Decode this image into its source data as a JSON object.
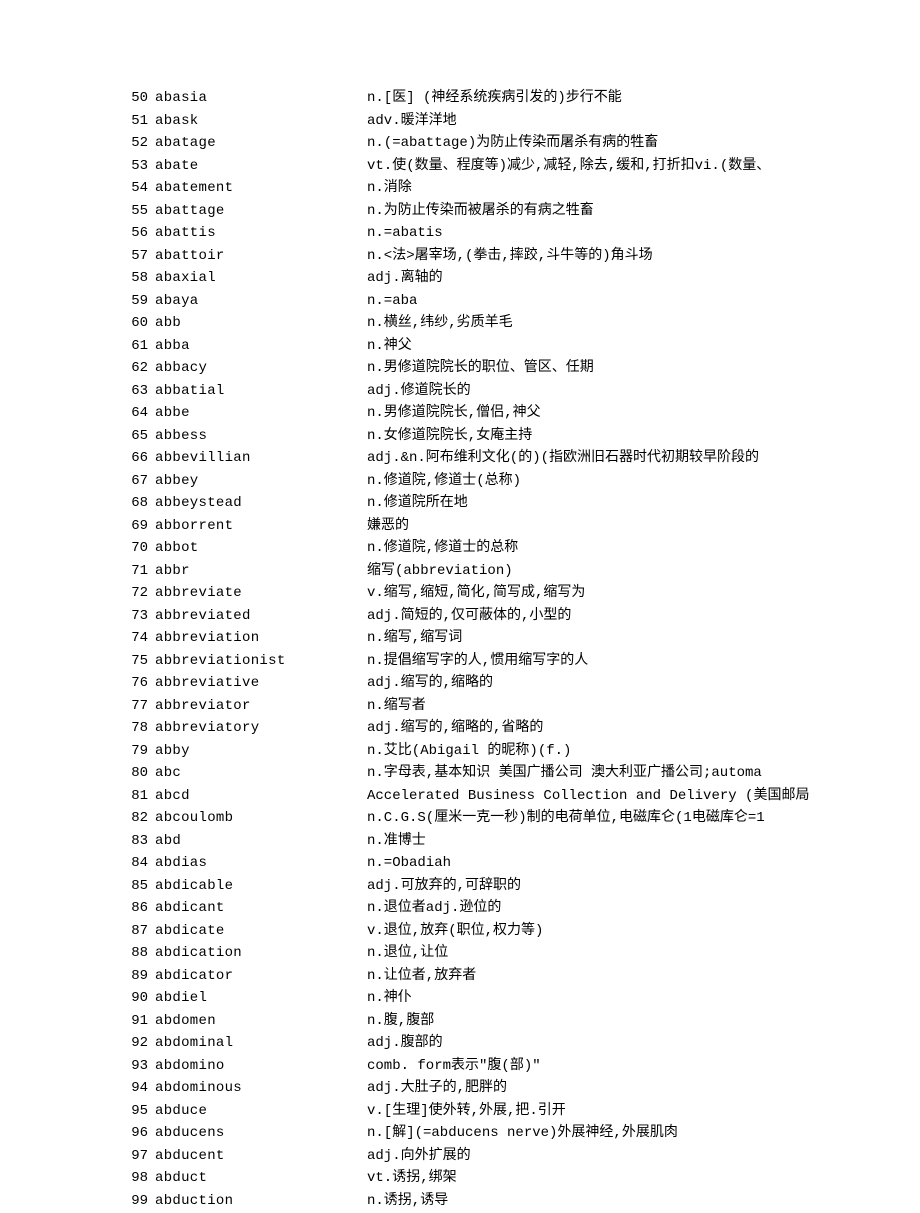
{
  "entries": [
    {
      "num": "50",
      "word": "abasia",
      "def": "n.[医] (神经系统疾病引发的)步行不能"
    },
    {
      "num": "51",
      "word": "abask",
      "def": "adv.暖洋洋地"
    },
    {
      "num": "52",
      "word": "abatage",
      "def": "n.(=abattage)为防止传染而屠杀有病的牲畜"
    },
    {
      "num": "53",
      "word": "abate",
      "def": "vt.使(数量、程度等)减少,减轻,除去,缓和,打折扣vi.(数量、"
    },
    {
      "num": "54",
      "word": "abatement",
      "def": "n.消除"
    },
    {
      "num": "55",
      "word": "abattage",
      "def": "n.为防止传染而被屠杀的有病之牲畜"
    },
    {
      "num": "56",
      "word": "abattis",
      "def": "n.=abatis"
    },
    {
      "num": "57",
      "word": "abattoir",
      "def": "n.<法>屠宰场,(拳击,摔跤,斗牛等的)角斗场"
    },
    {
      "num": "58",
      "word": "abaxial",
      "def": "adj.离轴的"
    },
    {
      "num": "59",
      "word": "abaya",
      "def": "n.=aba"
    },
    {
      "num": "60",
      "word": "abb",
      "def": "n.横丝,纬纱,劣质羊毛"
    },
    {
      "num": "61",
      "word": "abba",
      "def": "n.神父"
    },
    {
      "num": "62",
      "word": "abbacy",
      "def": "n.男修道院院长的职位、管区、任期"
    },
    {
      "num": "63",
      "word": "abbatial",
      "def": "adj.修道院长的"
    },
    {
      "num": "64",
      "word": "abbe",
      "def": "n.男修道院院长,僧侣,神父"
    },
    {
      "num": "65",
      "word": "abbess",
      "def": "n.女修道院院长,女庵主持"
    },
    {
      "num": "66",
      "word": "abbevillian",
      "def": "adj.&n.阿布维利文化(的)(指欧洲旧石器时代初期较早阶段的"
    },
    {
      "num": "67",
      "word": "abbey",
      "def": "n.修道院,修道士(总称)"
    },
    {
      "num": "68",
      "word": "abbeystead",
      "def": "n.修道院所在地"
    },
    {
      "num": "69",
      "word": "abborrent",
      "def": "嫌恶的"
    },
    {
      "num": "70",
      "word": "abbot",
      "def": "n.修道院,修道士的总称"
    },
    {
      "num": "71",
      "word": "abbr",
      "def": "缩写(abbreviation)"
    },
    {
      "num": "72",
      "word": "abbreviate",
      "def": "v.缩写,缩短,简化,简写成,缩写为"
    },
    {
      "num": "73",
      "word": "abbreviated",
      "def": "adj.简短的,仅可蔽体的,小型的"
    },
    {
      "num": "74",
      "word": "abbreviation",
      "def": "n.缩写,缩写词"
    },
    {
      "num": "75",
      "word": "abbreviationist",
      "def": "n.提倡缩写字的人,惯用缩写字的人"
    },
    {
      "num": "76",
      "word": "abbreviative",
      "def": "adj.缩写的,缩略的"
    },
    {
      "num": "77",
      "word": "abbreviator",
      "def": "n.缩写者"
    },
    {
      "num": "78",
      "word": "abbreviatory",
      "def": "adj.缩写的,缩略的,省略的"
    },
    {
      "num": "79",
      "word": "abby",
      "def": "n.艾比(Abigail 的昵称)(f.)"
    },
    {
      "num": "80",
      "word": "abc",
      "def": "n.字母表,基本知识 美国广播公司 澳大利亚广播公司;automa"
    },
    {
      "num": "81",
      "word": "abcd",
      "def": "Accelerated Business Collection and Delivery (美国邮局"
    },
    {
      "num": "82",
      "word": "abcoulomb",
      "def": "n.C.G.S(厘米一克一秒)制的电荷单位,电磁库仑(1电磁库仑=1"
    },
    {
      "num": "83",
      "word": "abd",
      "def": "n.准博士"
    },
    {
      "num": "84",
      "word": "abdias",
      "def": "n.=Obadiah"
    },
    {
      "num": "85",
      "word": "abdicable",
      "def": "adj.可放弃的,可辞职的"
    },
    {
      "num": "86",
      "word": "abdicant",
      "def": "n.退位者adj.逊位的"
    },
    {
      "num": "87",
      "word": "abdicate",
      "def": "v.退位,放弃(职位,权力等)"
    },
    {
      "num": "88",
      "word": "abdication",
      "def": "n.退位,让位"
    },
    {
      "num": "89",
      "word": "abdicator",
      "def": "n.让位者,放弃者"
    },
    {
      "num": "90",
      "word": "abdiel",
      "def": "n.神仆"
    },
    {
      "num": "91",
      "word": "abdomen",
      "def": "n.腹,腹部"
    },
    {
      "num": "92",
      "word": "abdominal",
      "def": "adj.腹部的"
    },
    {
      "num": "93",
      "word": "abdomino",
      "def": " comb. form表示\"腹(部)\""
    },
    {
      "num": "94",
      "word": "abdominous",
      "def": "adj.大肚子的,肥胖的"
    },
    {
      "num": "95",
      "word": "abduce",
      "def": "v.[生理]使外转,外展,把.引开"
    },
    {
      "num": "96",
      "word": "abducens",
      "def": "n.[解](=abducens nerve)外展神经,外展肌肉"
    },
    {
      "num": "97",
      "word": "abducent",
      "def": "adj.向外扩展的"
    },
    {
      "num": "98",
      "word": "abduct",
      "def": "vt.诱拐,绑架"
    },
    {
      "num": "99",
      "word": "abduction",
      "def": "n.诱拐,诱导"
    }
  ]
}
